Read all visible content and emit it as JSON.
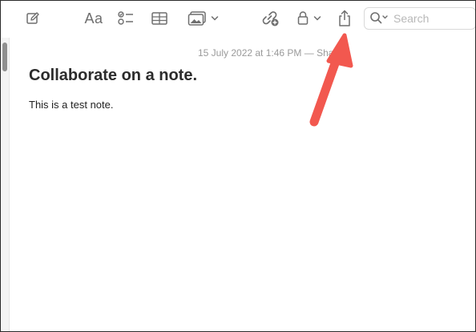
{
  "toolbar": {
    "format_label": "Aa",
    "search": {
      "placeholder": "Search",
      "value": ""
    }
  },
  "note": {
    "timestamp": "15 July 2022 at 1:46 PM — Shared",
    "title": "Collaborate on a note.",
    "body": "This is a test note."
  },
  "icons": [
    "compose-icon",
    "checklist-icon",
    "table-icon",
    "media-icon",
    "collaborate-icon",
    "lock-icon",
    "share-icon",
    "search-icon"
  ],
  "colors": {
    "annotation_arrow": "#f2584f",
    "icon_gray": "#6e6e6e"
  }
}
